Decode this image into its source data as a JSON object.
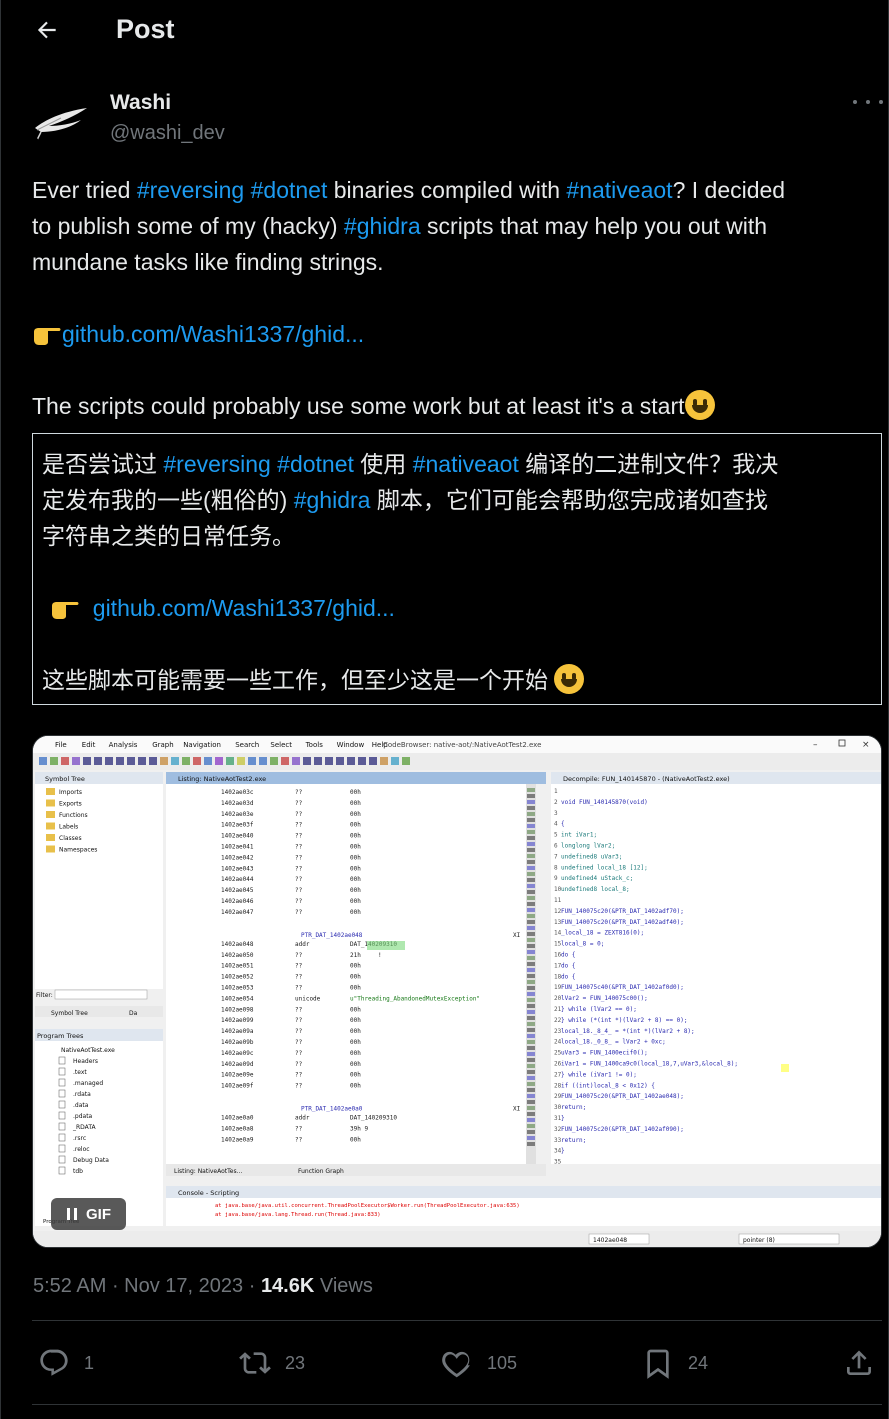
{
  "header": {
    "title": "Post"
  },
  "author": {
    "name": "Washi",
    "handle": "@washi_dev"
  },
  "post": {
    "line1": {
      "a": "Ever tried ",
      "tag1": "#reversing",
      "b": " ",
      "tag2": "#dotnet",
      "c": " binaries compiled with ",
      "tag3": "#nativeaot",
      "d": "? I decided"
    },
    "line2": {
      "a": "to publish some of my (hacky) ",
      "tag1": "#ghidra",
      "b": " scripts that may help you out with"
    },
    "line3": "mundane tasks like finding strings.",
    "link": "github.com/Washi1337/ghid...",
    "last_line": "The scripts could probably use some work but at least it's a start"
  },
  "translation": {
    "line1": {
      "a": "是否尝试过 ",
      "tag1": "#reversing",
      "b": "  ",
      "tag2": "#dotnet",
      "c": " 使用 ",
      "tag3": "#nativeaot",
      "d": " 编译的二进制文件？我决"
    },
    "line2": {
      "a": "定发布我的一些(粗俗的) ",
      "tag1": "#ghidra",
      "b": " 脚本，它们可能会帮助您完成诸如查找"
    },
    "line3": "字符串之类的日常任务。",
    "link": "github.com/Washi1337/ghid...",
    "last_line": "这些脚本可能需要一些工作，但至少这是一个开始 "
  },
  "media": {
    "gif_label": "GIF",
    "app": {
      "menus": [
        "File",
        "Edit",
        "Analysis",
        "Graph",
        "Navigation",
        "Search",
        "Select",
        "Tools",
        "Window",
        "Help"
      ],
      "window_title": "CodeBrowser: native-aot/:NativeAotTest2.exe",
      "symbol_tree_title": "Symbol Tree",
      "symbol_items": [
        "Imports",
        "Exports",
        "Functions",
        "Labels",
        "Classes",
        "Namespaces"
      ],
      "filter_label": "Filter:",
      "symbol_tab": "Symbol Tree",
      "da_tab": "Da",
      "program_trees_title": "Program Trees",
      "program_root": "NativeAotTest.exe",
      "program_items": [
        "Headers",
        ".text",
        ".managed",
        ".rdata",
        ".data",
        ".pdata",
        "_RDATA",
        ".rsrc",
        ".reloc",
        "Debug Data",
        "tdb"
      ],
      "program_tree_tab": "Program Tree",
      "listing_title": "Listing:  NativeAotTest2.exe",
      "listing_rows": [
        [
          "1402ae03c",
          "??",
          "00h"
        ],
        [
          "1402ae03d",
          "??",
          "00h"
        ],
        [
          "1402ae03e",
          "??",
          "00h"
        ],
        [
          "1402ae03f",
          "??",
          "00h"
        ],
        [
          "1402ae040",
          "??",
          "00h"
        ],
        [
          "1402ae041",
          "??",
          "00h"
        ],
        [
          "1402ae042",
          "??",
          "00h"
        ],
        [
          "1402ae043",
          "??",
          "00h"
        ],
        [
          "1402ae044",
          "??",
          "00h"
        ],
        [
          "1402ae045",
          "??",
          "00h"
        ],
        [
          "1402ae046",
          "??",
          "00h"
        ],
        [
          "1402ae047",
          "??",
          "00h"
        ]
      ],
      "ptr_label_1": "PTR_DAT_1402ae048",
      "xref_1": "XI",
      "addr_row": [
        "1402ae048",
        "addr",
        "DAT_140209310"
      ],
      "rows_2": [
        [
          "1402ae050",
          "??",
          "21h",
          "!"
        ],
        [
          "1402ae051",
          "??",
          "00h",
          ""
        ],
        [
          "1402ae052",
          "??",
          "00h",
          ""
        ],
        [
          "1402ae053",
          "??",
          "00h",
          ""
        ]
      ],
      "unicode_row": [
        "1402ae054",
        "unicode",
        "u\"Threading_AbandonedMutexException\""
      ],
      "rows_3": [
        [
          "1402ae098",
          "??",
          "00h"
        ],
        [
          "1402ae099",
          "??",
          "00h"
        ],
        [
          "1402ae09a",
          "??",
          "00h"
        ],
        [
          "1402ae09b",
          "??",
          "00h"
        ],
        [
          "1402ae09c",
          "??",
          "00h"
        ],
        [
          "1402ae09d",
          "??",
          "00h"
        ],
        [
          "1402ae09e",
          "??",
          "00h"
        ],
        [
          "1402ae09f",
          "??",
          "00h"
        ]
      ],
      "ptr_label_2": "PTR_DAT_1402ae0a0",
      "xref_2": "XI",
      "rows_4": [
        [
          "1402ae0a0",
          "addr",
          "DAT_140209310"
        ],
        [
          "1402ae0a8",
          "??",
          "39h    9"
        ],
        [
          "1402ae0a9",
          "??",
          "00h"
        ]
      ],
      "bottom_tab_listing": "Listing:  NativeAotTes...",
      "bottom_tab_graph": "Function Graph",
      "console_title": "Console - Scripting",
      "console_line1": "at java.base/java.util.concurrent.ThreadPoolExecutor$Worker.run(ThreadPoolExecutor.java:635)",
      "console_line2": "at java.base/java.lang.Thread.run(Thread.java:833)",
      "status_addr": "1402ae048",
      "status_type": "pointer (8)",
      "decompile_title": "Decompile: FUN_140145870 - (NativeAotTest2.exe)",
      "decompile_lines": [
        "",
        "void FUN_140145870(void)",
        "",
        "{",
        "  int iVar1;",
        "  longlong lVar2;",
        "  undefined8 uVar3;",
        "  undefined local_18 [12];",
        "  undefined4 uStack_c;",
        "  undefined8 local_8;",
        "",
        "  FUN_140075c20(&PTR_DAT_1402adf70);",
        "  FUN_140075c20(&PTR_DAT_1402adf40);",
        "  _local_18 = ZEXT816(0);",
        "  local_8 = 0;",
        "  do {",
        "    do {",
        "      do {",
        "        FUN_140075c40(&PTR_DAT_1402af0d0);",
        "        lVar2 = FUN_140075c00();",
        "      } while (lVar2 == 0);",
        "    } while (*(int *)(lVar2 + 8) == 0);",
        "    local_18._8_4_ = *(int *)(lVar2 + 8);",
        "    local_18._0_8_ = lVar2 + 0xc;",
        "    uVar3 = FUN_1400ecif0();",
        "    iVar1 = FUN_1400ca9c0(local_18,7,uVar3,&local_8);",
        "  } while (iVar1 != 0);",
        "  if ((int)local_8 < 0x12) {",
        "    FUN_140075c20(&PTR_DAT_1402ae048);",
        "    return;",
        "  }",
        "  FUN_140075c20(&PTR_DAT_1402af090);",
        "  return;",
        "}",
        ""
      ]
    }
  },
  "meta": {
    "time": "5:52 AM",
    "sep1": " · ",
    "date": "Nov 17, 2023",
    "sep2": " · ",
    "views": "14.6K",
    "views_label": " Views"
  },
  "actions": {
    "replies": "1",
    "reposts": "23",
    "likes": "105",
    "bookmarks": "24"
  },
  "colors": {
    "accent": "#1d9bf0",
    "muted": "#71767b",
    "text": "#e7e9ea"
  }
}
